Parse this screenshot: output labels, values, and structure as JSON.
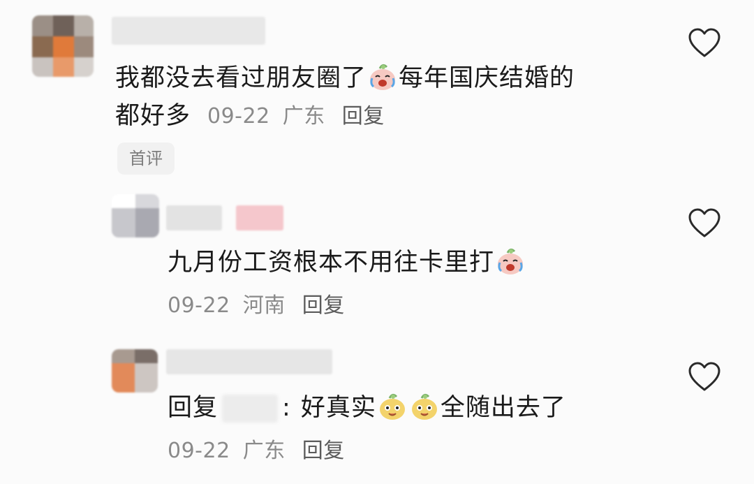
{
  "comments": [
    {
      "text_line1_a": "我都没去看过朋友圈了",
      "text_line1_b": "每年国庆结婚的",
      "text_line2": "都好多",
      "date": "09-22",
      "location": "广东",
      "reply_label": "回复",
      "badge": "首评",
      "emoji": "crying-laughing-emoji"
    },
    {
      "text_a": "九月份工资根本不用往卡里打",
      "date": "09-22",
      "location": "河南",
      "reply_label": "回复",
      "emoji": "crying-laughing-emoji"
    },
    {
      "prefix": "回复",
      "colon": ":",
      "text_a": "好真实",
      "text_b": "全随出去了",
      "date": "09-22",
      "location": "广东",
      "reply_label": "回复",
      "emoji": "pear-face-emoji"
    }
  ],
  "colors": {
    "background": "#fbfbfb",
    "text": "#1a1a1a",
    "meta": "#8a8a8a",
    "heart_stroke": "#2a2a2a"
  }
}
